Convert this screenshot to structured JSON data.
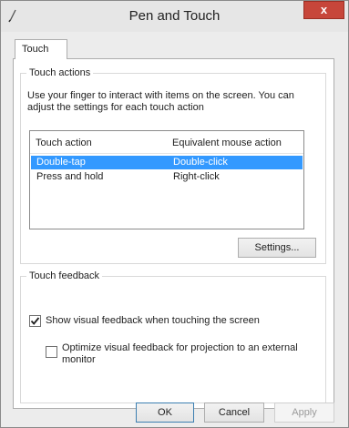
{
  "window": {
    "title": "Pen and Touch",
    "close_glyph": "x"
  },
  "tabs": [
    {
      "label": "Touch"
    }
  ],
  "touch_actions": {
    "group_label": "Touch actions",
    "description": "Use your finger to interact with items on the screen. You can adjust the settings for each touch action",
    "columns": [
      "Touch action",
      "Equivalent mouse action"
    ],
    "rows": [
      {
        "action": "Double-tap",
        "mouse": "Double-click",
        "selected": true
      },
      {
        "action": "Press and hold",
        "mouse": "Right-click",
        "selected": false
      }
    ],
    "settings_label": "Settings..."
  },
  "touch_feedback": {
    "group_label": "Touch feedback",
    "show_visual": {
      "label": "Show visual feedback when touching the screen",
      "checked": true
    },
    "optimize": {
      "label": "Optimize visual feedback for projection to an external monitor",
      "checked": false
    }
  },
  "footer": {
    "ok": "OK",
    "cancel": "Cancel",
    "apply": "Apply"
  },
  "colors": {
    "selection": "#3399ff",
    "close_button": "#c7463a"
  }
}
